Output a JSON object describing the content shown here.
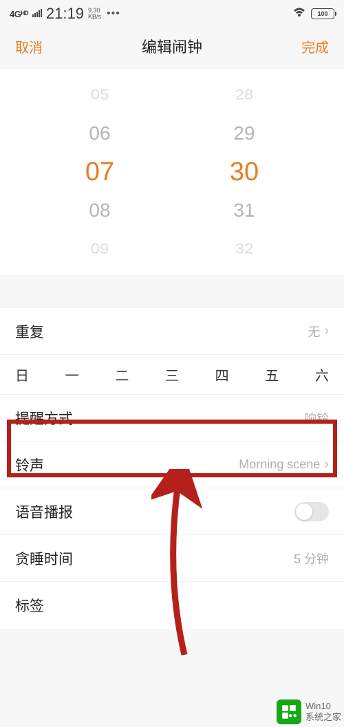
{
  "status": {
    "network": "4Gᴴᴰ",
    "time": "21:19",
    "speed_top": "9.30",
    "speed_bot": "KB/s",
    "battery": "100"
  },
  "nav": {
    "cancel": "取消",
    "title": "编辑闹钟",
    "done": "完成"
  },
  "picker": {
    "hours": [
      "05",
      "06",
      "07",
      "08",
      "09"
    ],
    "minutes": [
      "28",
      "29",
      "30",
      "31",
      "32"
    ]
  },
  "rows": {
    "repeat_label": "重复",
    "repeat_value": "无",
    "days": [
      "日",
      "一",
      "二",
      "三",
      "四",
      "五",
      "六"
    ],
    "remind_label": "提醒方式",
    "remind_value": "响铃",
    "ringtone_label": "铃声",
    "ringtone_value": "Morning scene",
    "voice_label": "语音播报",
    "snooze_label": "贪睡时间",
    "snooze_value": "5 分钟",
    "tag_label": "标签"
  },
  "watermark": {
    "line1": "Win10",
    "line2": "系统之家"
  }
}
